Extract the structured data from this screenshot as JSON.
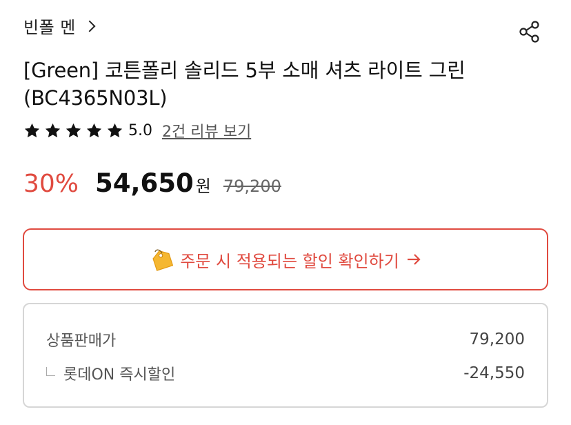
{
  "brand": {
    "name": "빈폴 멘"
  },
  "product": {
    "title": "[Green] 코튼폴리 솔리드 5부 소매 셔츠 라이트 그린 (BC4365N03L)"
  },
  "rating": {
    "stars": 5,
    "max_stars": 5,
    "score": "5.0",
    "review_link": "2건 리뷰 보기"
  },
  "pricing": {
    "discount_rate": "30%",
    "sale_price": "54,650",
    "currency": "원",
    "original_price": "79,200"
  },
  "coupon": {
    "label": "주문 시 적용되는 할인 확인하기",
    "icon": "price-tag-icon",
    "arrow": "→"
  },
  "breakdown": {
    "rows": [
      {
        "label": "상품판매가",
        "value": "79,200"
      },
      {
        "label": "롯데ON 즉시할인",
        "value": "-24,550"
      }
    ]
  },
  "colors": {
    "accent": "#e04a3f",
    "text": "#111111",
    "muted": "#555555",
    "border": "#d6d6d6"
  }
}
